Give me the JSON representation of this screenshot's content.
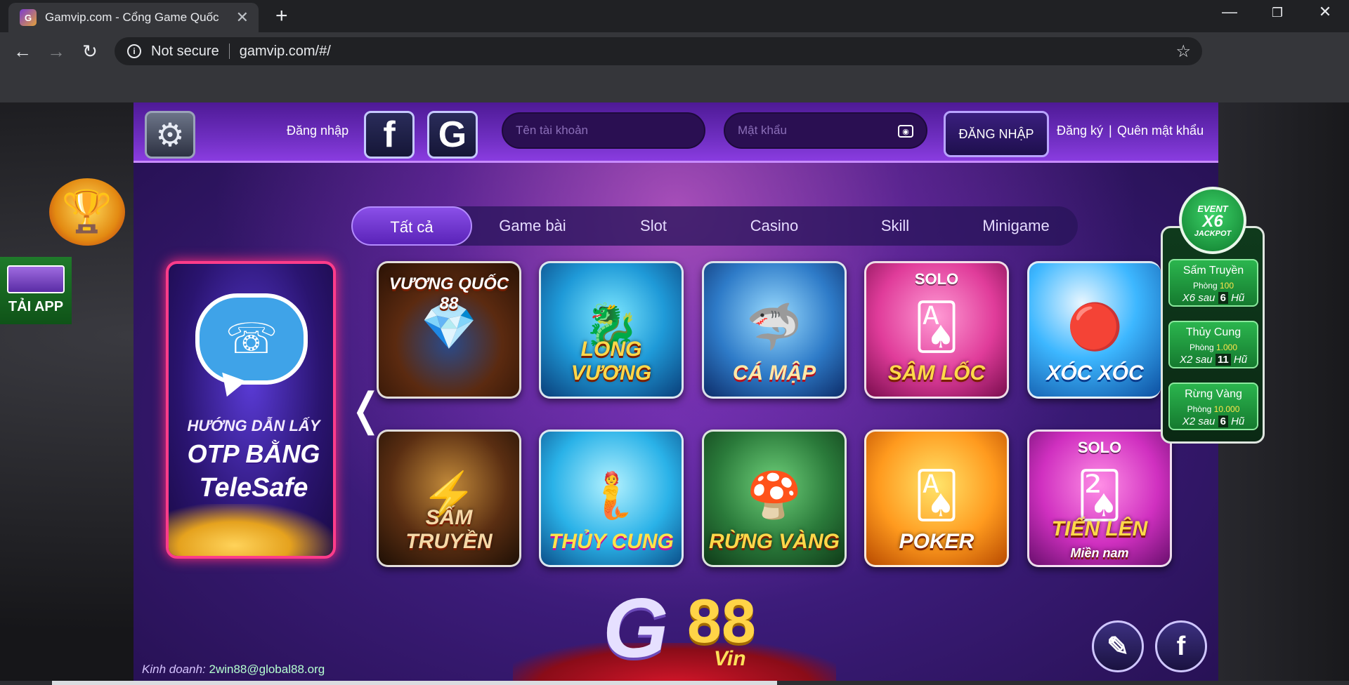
{
  "browser": {
    "tab_title": "Gamvip.com - Cổng Game Quốc",
    "favicon_glyph": "G",
    "security_label": "Not secure",
    "url": "gamvip.com/#/"
  },
  "header": {
    "login_label": "Đăng nhập",
    "facebook_glyph": "f",
    "google_glyph": "G",
    "username_placeholder": "Tên tài khoản",
    "password_placeholder": "Mật khẩu",
    "login_button": "ĐĂNG NHẬP",
    "register_link": "Đăng ký",
    "separator": "|",
    "forgot_link": "Quên mật khẩu"
  },
  "tabs": [
    {
      "label": "Tất cả",
      "active": true
    },
    {
      "label": "Game bài",
      "active": false
    },
    {
      "label": "Slot",
      "active": false
    },
    {
      "label": "Casino",
      "active": false
    },
    {
      "label": "Skill",
      "active": false
    },
    {
      "label": "Minigame",
      "active": false
    }
  ],
  "banner": {
    "line1": "HƯỚNG DẪN LẤY",
    "line2": "OTP BẰNG",
    "line3": "TeleSafe"
  },
  "games": [
    {
      "title": "VƯƠNG QUỐC 88",
      "sub": "",
      "emblem": "💎"
    },
    {
      "title": "LONG VƯƠNG",
      "sub": "",
      "emblem": "🐉"
    },
    {
      "title": "CÁ MẬP",
      "sub": "",
      "emblem": "🦈"
    },
    {
      "title": "SÂM LỐC",
      "sub": "SOLO",
      "emblem": "🂡"
    },
    {
      "title": "XÓC XÓC",
      "sub": "",
      "emblem": "🔴"
    },
    {
      "title": "SẤM TRUYỀN",
      "sub": "",
      "emblem": "⚡"
    },
    {
      "title": "THỦY CUNG",
      "sub": "",
      "emblem": "🧜"
    },
    {
      "title": "RỪNG VÀNG",
      "sub": "",
      "emblem": "🍄"
    },
    {
      "title": "POKER",
      "sub": "",
      "emblem": "🂡"
    },
    {
      "title": "TIẾN LÊN",
      "sub": "SOLO",
      "emblem": "🂢",
      "subtitle2": "Miền nam"
    }
  ],
  "jackpot": {
    "badge_top": "EVENT",
    "badge_mult": "X6",
    "badge_bottom": "JACKPOT",
    "items": [
      {
        "name": "Sấm Truyền",
        "room_label": "Phòng",
        "room_value": "100",
        "mult": "X6 sau",
        "count": "6",
        "unit": "Hũ"
      },
      {
        "name": "Thủy Cung",
        "room_label": "Phòng",
        "room_value": "1.000",
        "mult": "X2 sau",
        "count": "11",
        "unit": "Hũ"
      },
      {
        "name": "Rừng Vàng",
        "room_label": "Phòng",
        "room_value": "10.000",
        "mult": "X2 sau",
        "count": "6",
        "unit": "Hũ"
      }
    ]
  },
  "left": {
    "download_label": "TẢI APP"
  },
  "footer": {
    "business_label": "Kinh doanh:",
    "business_email": "2win88@global88.org",
    "logo_g": "G",
    "logo_88": "88",
    "logo_vin": "Vin"
  },
  "colors": {
    "accent_purple": "#6e2ec0",
    "tab_active": "#8a4fe8",
    "jackpot_green": "#2bb54e",
    "banner_border": "#ff3c8a"
  }
}
